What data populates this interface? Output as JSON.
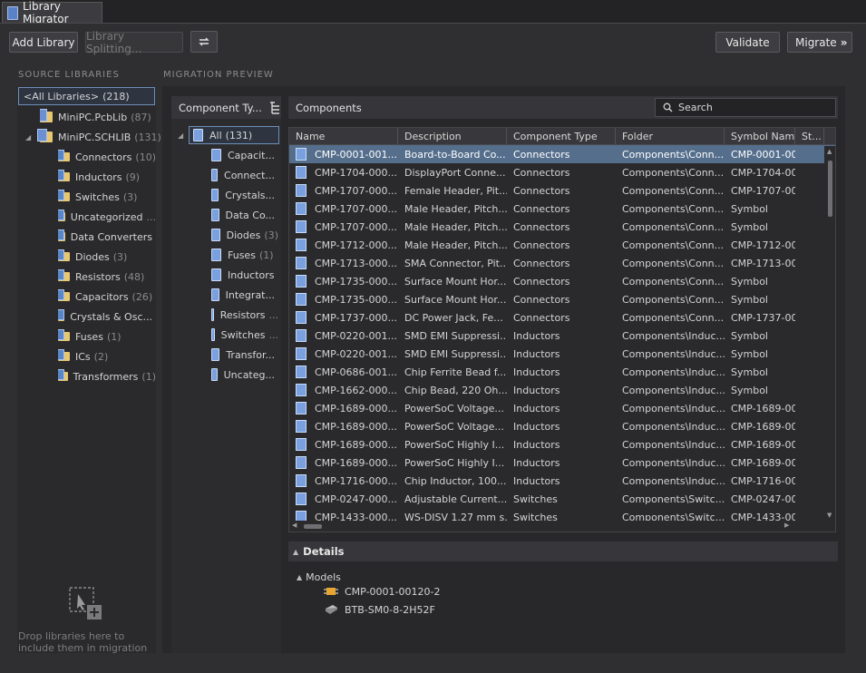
{
  "window": {
    "tab_title": "Library Migrator"
  },
  "toolbar": {
    "add_library": "Add Library",
    "library_splitting": "Library Splitting...",
    "validate": "Validate",
    "migrate": "Migrate"
  },
  "source": {
    "title": "SOURCE LIBRARIES",
    "all_label": "<All Libraries>",
    "all_count": "(218)",
    "pcblib": {
      "name": "MiniPC.PcbLib",
      "count": "(87)"
    },
    "schlib": {
      "name": "MiniPC.SCHLIB",
      "count": "(131)"
    },
    "folders": [
      {
        "name": "Connectors",
        "count": "(10)"
      },
      {
        "name": "Inductors",
        "count": "(9)"
      },
      {
        "name": "Switches",
        "count": "(3)"
      },
      {
        "name": "Uncategorized",
        "count": "..."
      },
      {
        "name": "Data Converters",
        "count": ""
      },
      {
        "name": "Diodes",
        "count": "(3)"
      },
      {
        "name": "Resistors",
        "count": "(48)"
      },
      {
        "name": "Capacitors",
        "count": "(26)"
      },
      {
        "name": "Crystals & Osc...",
        "count": ""
      },
      {
        "name": "Fuses",
        "count": "(1)"
      },
      {
        "name": "ICs",
        "count": "(2)"
      },
      {
        "name": "Transformers",
        "count": "(1)"
      }
    ],
    "drop_hint": "Drop libraries here to include them in migration"
  },
  "preview": {
    "title": "MIGRATION PREVIEW",
    "component_types_header": "Component Ty...",
    "all_label": "All",
    "all_count": "(131)",
    "types": [
      {
        "name": "Capacit...",
        "count": ""
      },
      {
        "name": "Connect...",
        "count": ""
      },
      {
        "name": "Crystals...",
        "count": ""
      },
      {
        "name": "Data Co...",
        "count": ""
      },
      {
        "name": "Diodes",
        "count": "(3)"
      },
      {
        "name": "Fuses",
        "count": "(1)"
      },
      {
        "name": "Inductors",
        "count": ""
      },
      {
        "name": "Integrat...",
        "count": ""
      },
      {
        "name": "Resistors",
        "count": "..."
      },
      {
        "name": "Switches",
        "count": "..."
      },
      {
        "name": "Transfor...",
        "count": ""
      },
      {
        "name": "Uncateg...",
        "count": ""
      }
    ],
    "components_header": "Components",
    "search_placeholder": "Search",
    "columns": [
      "Name",
      "Description",
      "Component Type",
      "Folder",
      "Symbol Name",
      "St..."
    ],
    "rows": [
      [
        "CMP-0001-001...",
        "Board-to-Board Co...",
        "Connectors",
        "Components\\Conn...",
        "CMP-0001-001"
      ],
      [
        "CMP-1704-000...",
        "DisplayPort Conne...",
        "Connectors",
        "Components\\Conn...",
        "CMP-1704-000"
      ],
      [
        "CMP-1707-000...",
        "Female Header, Pit...",
        "Connectors",
        "Components\\Conn...",
        "CMP-1707-000"
      ],
      [
        "CMP-1707-000...",
        "Male Header, Pitch...",
        "Connectors",
        "Components\\Conn...",
        "Symbol"
      ],
      [
        "CMP-1707-000...",
        "Male Header, Pitch...",
        "Connectors",
        "Components\\Conn...",
        "Symbol"
      ],
      [
        "CMP-1712-000...",
        "Male Header, Pitch...",
        "Connectors",
        "Components\\Conn...",
        "CMP-1712-000"
      ],
      [
        "CMP-1713-000...",
        "SMA Connector, Pit...",
        "Connectors",
        "Components\\Conn...",
        "CMP-1713-000"
      ],
      [
        "CMP-1735-000...",
        "Surface Mount Hor...",
        "Connectors",
        "Components\\Conn...",
        "Symbol"
      ],
      [
        "CMP-1735-000...",
        "Surface Mount Hor...",
        "Connectors",
        "Components\\Conn...",
        "Symbol"
      ],
      [
        "CMP-1737-000...",
        "DC Power Jack, Fe...",
        "Connectors",
        "Components\\Conn...",
        "CMP-1737-000"
      ],
      [
        "CMP-0220-001...",
        "SMD EMI Suppressi...",
        "Inductors",
        "Components\\Induc...",
        "Symbol"
      ],
      [
        "CMP-0220-001...",
        "SMD EMI Suppressi...",
        "Inductors",
        "Components\\Induc...",
        "Symbol"
      ],
      [
        "CMP-0686-001...",
        "Chip Ferrite Bead f...",
        "Inductors",
        "Components\\Induc...",
        "Symbol"
      ],
      [
        "CMP-1662-000...",
        "Chip Bead, 220 Oh...",
        "Inductors",
        "Components\\Induc...",
        "Symbol"
      ],
      [
        "CMP-1689-000...",
        "PowerSoC Voltage...",
        "Inductors",
        "Components\\Induc...",
        "CMP-1689-000"
      ],
      [
        "CMP-1689-000...",
        "PowerSoC Voltage...",
        "Inductors",
        "Components\\Induc...",
        "CMP-1689-000"
      ],
      [
        "CMP-1689-000...",
        "PowerSoC Highly I...",
        "Inductors",
        "Components\\Induc...",
        "CMP-1689-000"
      ],
      [
        "CMP-1689-000...",
        "PowerSoC Highly I...",
        "Inductors",
        "Components\\Induc...",
        "CMP-1689-000"
      ],
      [
        "CMP-1716-000...",
        "Chip Inductor, 100...",
        "Inductors",
        "Components\\Induc...",
        "CMP-1716-000"
      ],
      [
        "CMP-0247-000...",
        "Adjustable Current...",
        "Switches",
        "Components\\Switc...",
        "CMP-0247-000"
      ],
      [
        "CMP-1433-000...",
        "WS-DISV 1.27 mm s...",
        "Switches",
        "Components\\Switc...",
        "CMP-1433-000"
      ]
    ],
    "details_header": "Details",
    "models_header": "Models",
    "models": [
      "CMP-0001-00120-2",
      "BTB-SM0-8-2H52F"
    ]
  }
}
